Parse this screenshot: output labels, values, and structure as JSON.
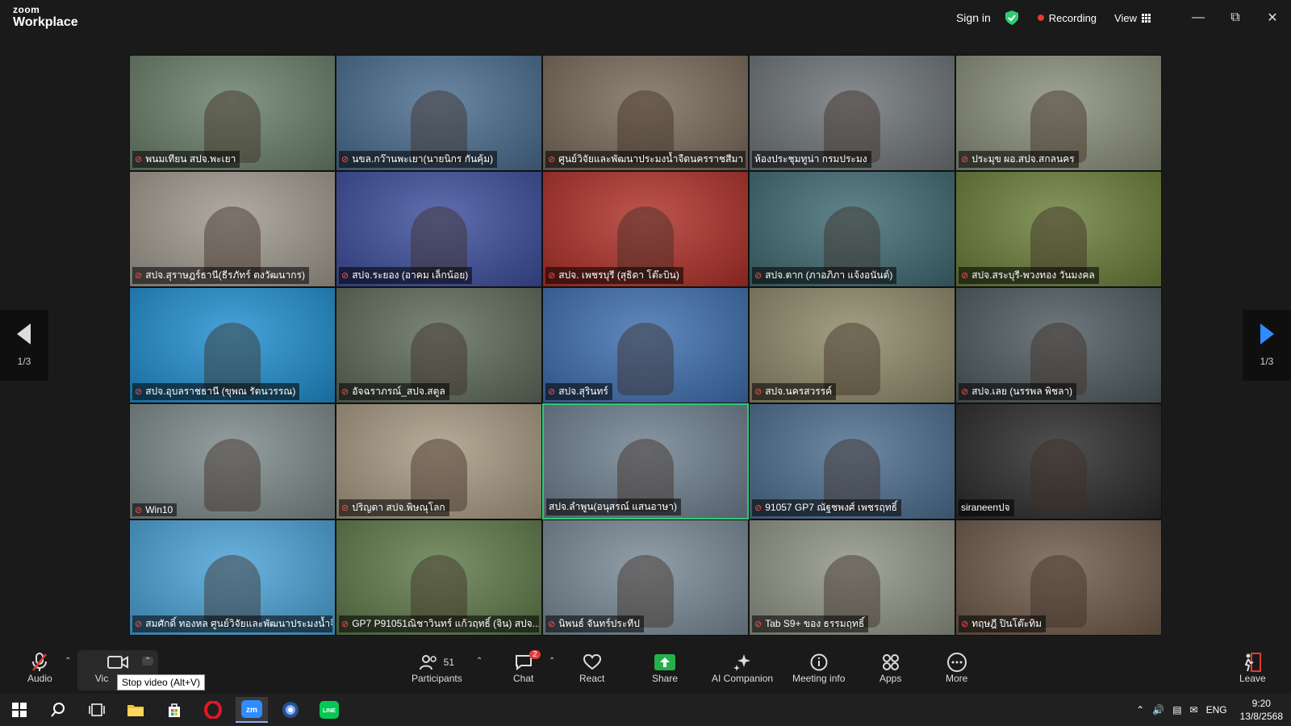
{
  "app": {
    "brand_top": "zoom",
    "brand_bottom": "Workplace"
  },
  "titlebar": {
    "sign_in": "Sign in",
    "recording": "Recording",
    "view": "View"
  },
  "nav": {
    "page_indicator": "1/3"
  },
  "participants": [
    {
      "name": "พนมเทียน สปจ.พะเยา",
      "muted": true,
      "bg": "#6b7f6a"
    },
    {
      "name": "นขล.กว๊านพะเยา(นายนิกร กันคุ้ม)",
      "muted": true,
      "bg": "#4a6d8f"
    },
    {
      "name": "ศูนย์วิจัยและพัฒนาประมงน้ำจืดนครราชสีมา",
      "muted": true,
      "bg": "#7a6a5a"
    },
    {
      "name": "ห้องประชุมทูน่า กรมประมง",
      "muted": false,
      "bg": "#6e7478"
    },
    {
      "name": "ประมุข ผอ.สปจ.สกลนคร",
      "muted": true,
      "bg": "#8a8f7a"
    },
    {
      "name": "สปจ.สุราษฎร์ธานี(ธีรภัทร์ ตงวัฒนากร)",
      "muted": true,
      "bg": "#a09a8f"
    },
    {
      "name": "สปจ.ระยอง (อาคม เล็กน้อย)",
      "muted": true,
      "bg": "#3d4e9e"
    },
    {
      "name": "สปจ. เพชรบุรี (สุธิดา โต๊ะบิน)",
      "muted": true,
      "bg": "#b03028"
    },
    {
      "name": "สปจ.ตาก (ภาอภิภา แจ้งอนันต์)",
      "muted": true,
      "bg": "#3f6a72"
    },
    {
      "name": "สปจ.สระบุรี-พวงทอง วันมงคล",
      "muted": true,
      "bg": "#6a7f3a"
    },
    {
      "name": "สปจ.อุบลราชธานี (ขุพณ รัตนวรรณ)",
      "muted": true,
      "bg": "#1f8fd0"
    },
    {
      "name": "อัจฉราภรณ์_สปจ.สตูล",
      "muted": true,
      "bg": "#5d6b5a"
    },
    {
      "name": "สปจ.สุรินทร์",
      "muted": true,
      "bg": "#3e6fb0"
    },
    {
      "name": "สปจ.นครสวรรค์",
      "muted": true,
      "bg": "#8f8a6a"
    },
    {
      "name": "สปจ.เลย (นรรพล พิชลา)",
      "muted": true,
      "bg": "#4f5a5f"
    },
    {
      "name": "Win10",
      "muted": true,
      "bg": "#7d8a8a"
    },
    {
      "name": "ปริญดา สปจ.พิษณุโลก",
      "muted": true,
      "bg": "#a89a82"
    },
    {
      "name": "สปจ.ลำพูน(อนุสรณ์ แสนอาษา)",
      "muted": false,
      "bg": "#6f8090"
    },
    {
      "name": "91057 GP7 ณัฐชพงศ์ เพชรฤทธิ์",
      "muted": true,
      "bg": "#4d6e8f"
    },
    {
      "name": "siraneenปจ",
      "muted": false,
      "bg": "#2a2a2a"
    },
    {
      "name": "สมศักดิ์ ทองหล ศูนย์วิจัยและพัฒนาประมงน้ำจื...",
      "muted": true,
      "bg": "#4aa3d8"
    },
    {
      "name": "GP7 P91051ณิชาวินทร์ แก้วฤทธิ์ (จิน) สปจ....",
      "muted": true,
      "bg": "#5f7a4a"
    },
    {
      "name": "นิพนธ์ จันทร์ประทีป",
      "muted": true,
      "bg": "#7a8a96"
    },
    {
      "name": "Tab S9+ ของ ธรรมฤทธิ์",
      "muted": true,
      "bg": "#8f9486"
    },
    {
      "name": "ทฤษฎี ปินโต๊ะทิม",
      "muted": true,
      "bg": "#6e5a4a"
    }
  ],
  "toolbar": {
    "audio": "Audio",
    "video": "Vic",
    "participants": "Participants",
    "participant_count": "51",
    "chat": "Chat",
    "chat_badge": "2",
    "react": "React",
    "share": "Share",
    "ai": "AI Companion",
    "meeting_info": "Meeting info",
    "apps": "Apps",
    "more": "More",
    "leave": "Leave",
    "tooltip": "Stop video (Alt+V)"
  },
  "taskbar": {
    "lang": "ENG",
    "time": "9:20",
    "date": "13/8/2568"
  },
  "colors": {
    "active_border": "#2ecc71",
    "recording": "#e53935",
    "share": "#26b04b"
  }
}
